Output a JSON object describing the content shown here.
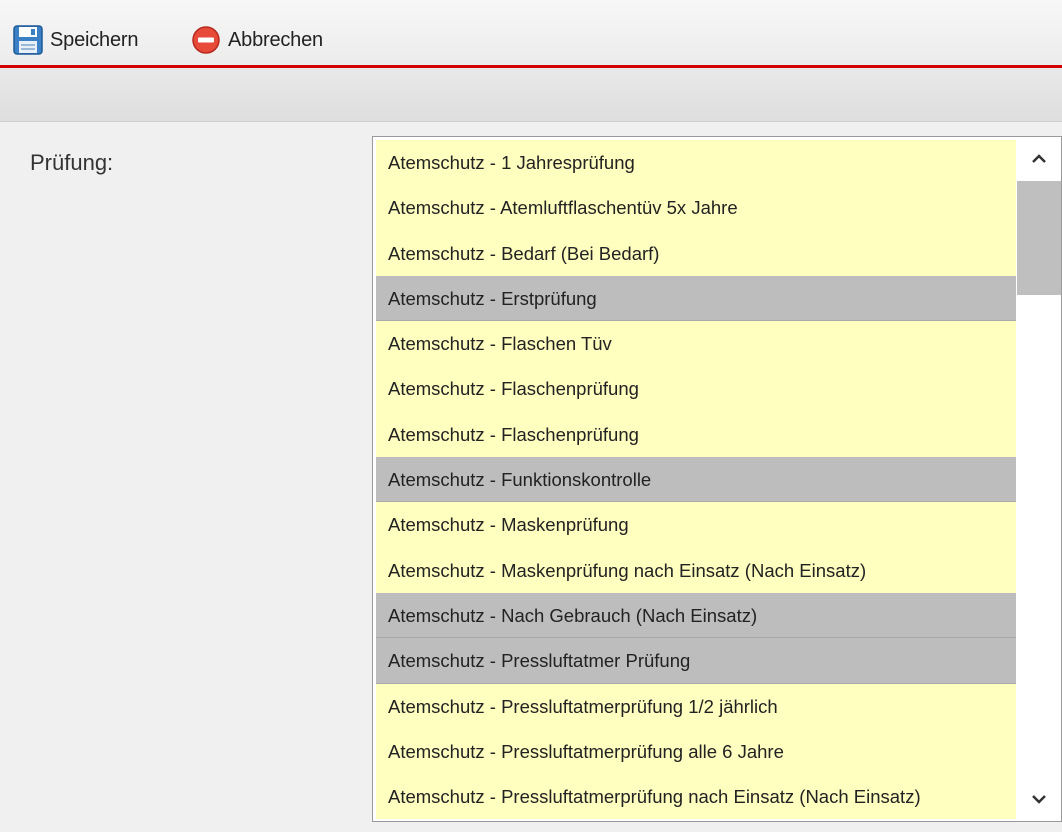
{
  "toolbar": {
    "save_label": "Speichern",
    "cancel_label": "Abbrechen"
  },
  "form": {
    "pruefung_label": "Prüfung:"
  },
  "pruefung_list": {
    "items": [
      {
        "label": "Atemschutz - 1 Jahresprüfung",
        "style": "normal"
      },
      {
        "label": "Atemschutz - Atemluftflaschentüv 5x Jahre",
        "style": "normal"
      },
      {
        "label": "Atemschutz - Bedarf (Bei Bedarf)",
        "style": "normal"
      },
      {
        "label": "Atemschutz - Erstprüfung",
        "style": "grey"
      },
      {
        "label": "Atemschutz - Flaschen Tüv",
        "style": "normal"
      },
      {
        "label": "Atemschutz - Flaschenprüfung",
        "style": "normal"
      },
      {
        "label": "Atemschutz - Flaschenprüfung",
        "style": "normal"
      },
      {
        "label": "Atemschutz - Funktionskontrolle",
        "style": "grey"
      },
      {
        "label": "Atemschutz - Maskenprüfung",
        "style": "normal"
      },
      {
        "label": "Atemschutz - Maskenprüfung nach Einsatz (Nach Einsatz)",
        "style": "normal"
      },
      {
        "label": "Atemschutz - Nach Gebrauch (Nach Einsatz)",
        "style": "grey"
      },
      {
        "label": "Atemschutz - Pressluftatmer Prüfung",
        "style": "grey"
      },
      {
        "label": "Atemschutz - Pressluftatmerprüfung 1/2 jährlich",
        "style": "normal"
      },
      {
        "label": "Atemschutz - Pressluftatmerprüfung alle 6 Jahre",
        "style": "normal"
      },
      {
        "label": "Atemschutz - Pressluftatmerprüfung nach Einsatz (Nach Einsatz)",
        "style": "normal"
      }
    ]
  },
  "colors": {
    "accent_line": "#d40000",
    "item_normal": "#ffffc0",
    "item_grey": "#bdbdbd"
  },
  "icons": {
    "save": "floppy-disk-icon",
    "cancel": "minus-circle-icon",
    "scroll_up": "chevron-up-icon",
    "scroll_down": "chevron-down-icon"
  }
}
